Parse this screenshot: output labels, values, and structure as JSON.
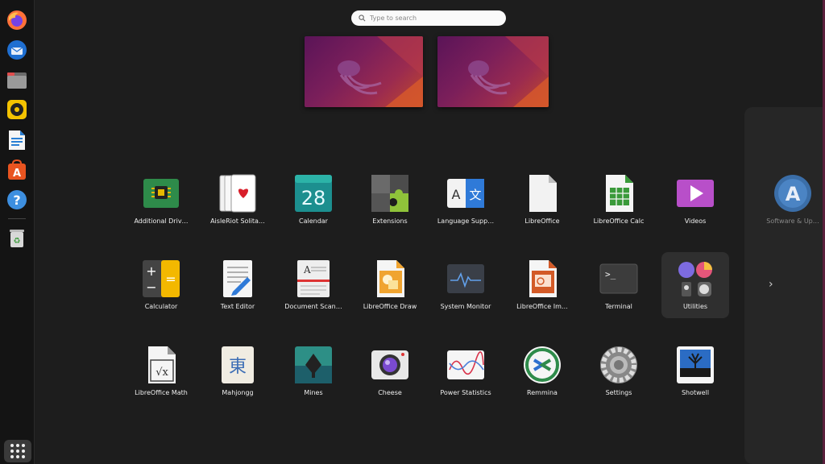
{
  "search": {
    "placeholder": "Type to search"
  },
  "dock": {
    "items": [
      {
        "name": "firefox-icon",
        "tooltip": "Firefox"
      },
      {
        "name": "thunderbird-icon",
        "tooltip": "Thunderbird Mail"
      },
      {
        "name": "files-icon",
        "tooltip": "Files"
      },
      {
        "name": "rhythmbox-icon",
        "tooltip": "Rhythmbox"
      },
      {
        "name": "libreoffice-writer-icon",
        "tooltip": "LibreOffice Writer"
      },
      {
        "name": "ubuntu-software-icon",
        "tooltip": "Ubuntu Software"
      },
      {
        "name": "help-icon",
        "tooltip": "Help"
      },
      {
        "name": "trash-icon",
        "tooltip": "Trash"
      }
    ],
    "show_apps_icon": "grid-icon"
  },
  "apps": {
    "row1": [
      "Additional Driv…",
      "AisleRiot Solita…",
      "Calendar",
      "Extensions",
      "Language Supp…",
      "LibreOffice",
      "LibreOffice Calc",
      "Videos"
    ],
    "row2": [
      "Calculator",
      "Text Editor",
      "Document Scan…",
      "LibreOffice Draw",
      "System Monitor",
      "LibreOffice Im…",
      "Terminal",
      "Utilities"
    ],
    "row3": [
      "LibreOffice Math",
      "Mahjongg",
      "Mines",
      "Cheese",
      "Power Statistics",
      "Remmina",
      "Settings",
      "Shotwell"
    ],
    "next_page": "Software & Up…",
    "calendar_day": "28",
    "mahjongg_glyph": "東",
    "language_glyphs": [
      "A",
      "文"
    ]
  },
  "colors": {
    "background": "#1d1d1d",
    "dock": "#141414",
    "wallpaper": [
      "#5a1458",
      "#c24a2a"
    ]
  }
}
